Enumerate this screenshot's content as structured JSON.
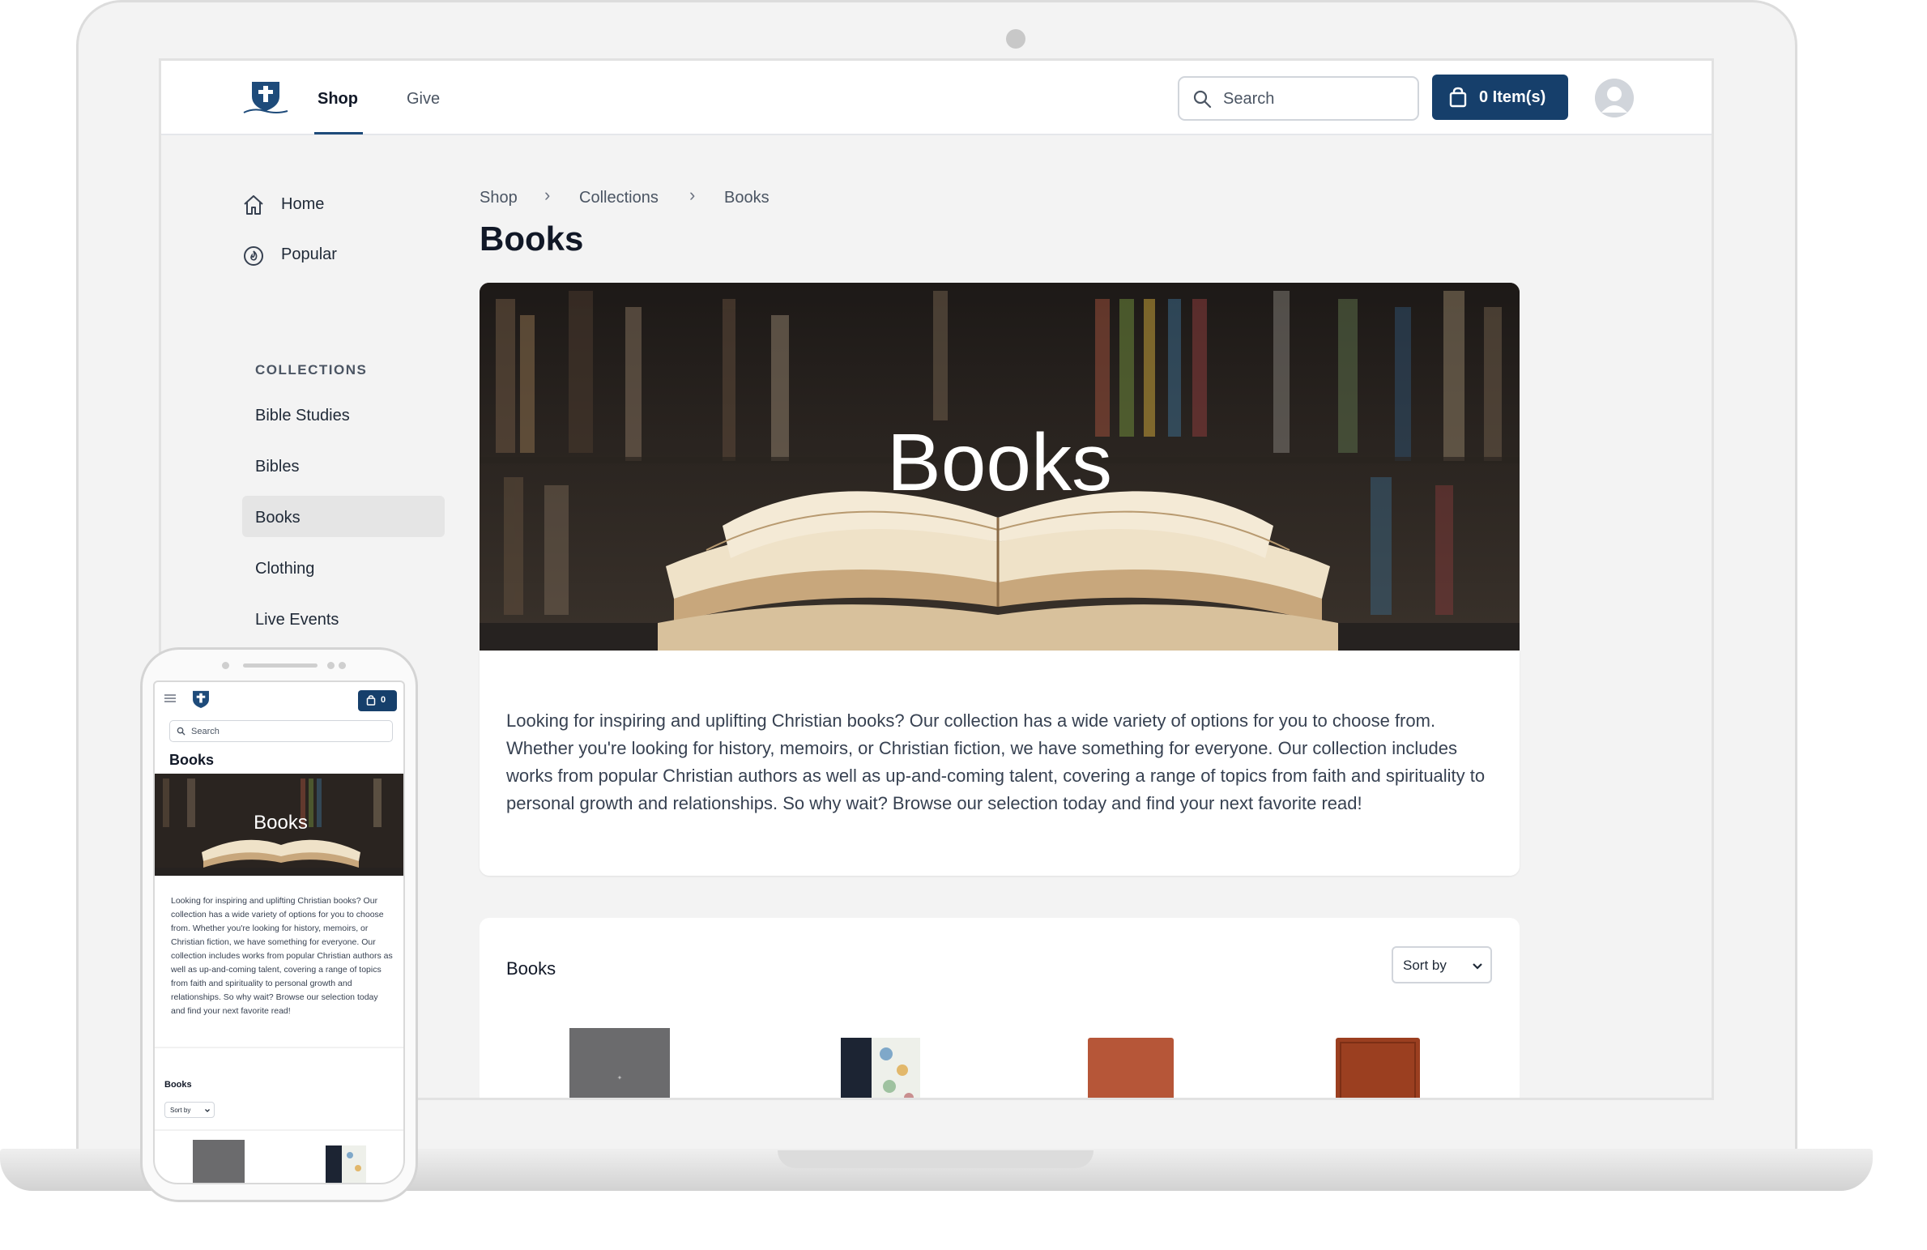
{
  "header": {
    "nav_tabs": [
      "Shop",
      "Give"
    ],
    "search_placeholder": "Search",
    "cart_label": "0 Item(s)"
  },
  "sidebar": {
    "items": [
      "Home",
      "Popular"
    ],
    "collections_heading": "COLLECTIONS",
    "collections": [
      "Bible Studies",
      "Bibles",
      "Books",
      "Clothing",
      "Live Events"
    ],
    "active_collection": "Books"
  },
  "breadcrumb": [
    "Shop",
    "Collections",
    "Books"
  ],
  "page_title": "Books",
  "hero_title": "Books",
  "description": "Looking for inspiring and uplifting Christian books? Our collection has a wide variety of options for you to choose from. Whether you're looking for history, memoirs, or Christian fiction, we have something for everyone. Our collection includes works from popular Christian authors as well as up-and-coming talent, covering a range of topics from faith and spirituality to personal growth and relationships. So why wait? Browse our selection today and find your next favorite read!",
  "product_list": {
    "title": "Books",
    "sort_label": "Sort by"
  },
  "mobile": {
    "cart_count": "0",
    "search_placeholder": "Search",
    "page_title": "Books",
    "hero_title": "Books",
    "description": "Looking for inspiring and uplifting Christian books? Our collection has a wide variety of options for you to choose from. Whether you're looking for history, memoirs, or Christian fiction, we have something for everyone. Our collection includes works from popular Christian authors as well as up-and-coming talent, covering a range of topics from faith and spirituality to personal growth and relationships. So why wait? Browse our selection today and find your next favorite read!",
    "list_title": "Books",
    "sort_label": "Sort by"
  },
  "colors": {
    "brand": "#163f6b",
    "active_bg": "#e5e5e5",
    "page_bg": "#f3f3f3"
  }
}
